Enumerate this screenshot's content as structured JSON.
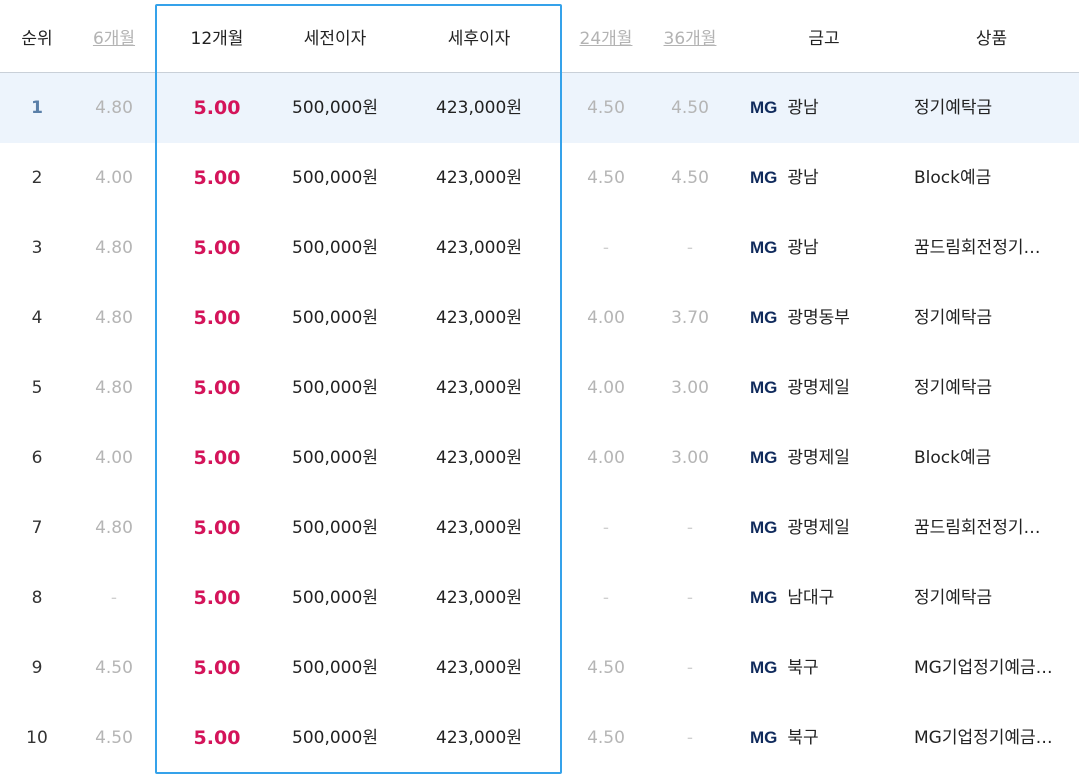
{
  "header": {
    "rank": "순위",
    "m6": "6개월",
    "m12": "12개월",
    "pretax": "세전이자",
    "posttax": "세후이자",
    "m24": "24개월",
    "m36": "36개월",
    "bank": "금고",
    "product": "상품"
  },
  "rows": [
    {
      "rank": "1",
      "m6": "4.80",
      "m12": "5.00",
      "pretax": "500,000원",
      "posttax": "423,000원",
      "m24": "4.50",
      "m36": "4.50",
      "brand": "MG",
      "bank": "광남",
      "product": "정기예탁금"
    },
    {
      "rank": "2",
      "m6": "4.00",
      "m12": "5.00",
      "pretax": "500,000원",
      "posttax": "423,000원",
      "m24": "4.50",
      "m36": "4.50",
      "brand": "MG",
      "bank": "광남",
      "product": "Block예금"
    },
    {
      "rank": "3",
      "m6": "4.80",
      "m12": "5.00",
      "pretax": "500,000원",
      "posttax": "423,000원",
      "m24": "-",
      "m36": "-",
      "brand": "MG",
      "bank": "광남",
      "product": "꿈드림회전정기…"
    },
    {
      "rank": "4",
      "m6": "4.80",
      "m12": "5.00",
      "pretax": "500,000원",
      "posttax": "423,000원",
      "m24": "4.00",
      "m36": "3.70",
      "brand": "MG",
      "bank": "광명동부",
      "product": "정기예탁금"
    },
    {
      "rank": "5",
      "m6": "4.80",
      "m12": "5.00",
      "pretax": "500,000원",
      "posttax": "423,000원",
      "m24": "4.00",
      "m36": "3.00",
      "brand": "MG",
      "bank": "광명제일",
      "product": "정기예탁금"
    },
    {
      "rank": "6",
      "m6": "4.00",
      "m12": "5.00",
      "pretax": "500,000원",
      "posttax": "423,000원",
      "m24": "4.00",
      "m36": "3.00",
      "brand": "MG",
      "bank": "광명제일",
      "product": "Block예금"
    },
    {
      "rank": "7",
      "m6": "4.80",
      "m12": "5.00",
      "pretax": "500,000원",
      "posttax": "423,000원",
      "m24": "-",
      "m36": "-",
      "brand": "MG",
      "bank": "광명제일",
      "product": "꿈드림회전정기…"
    },
    {
      "rank": "8",
      "m6": "-",
      "m12": "5.00",
      "pretax": "500,000원",
      "posttax": "423,000원",
      "m24": "-",
      "m36": "-",
      "brand": "MG",
      "bank": "남대구",
      "product": "정기예탁금"
    },
    {
      "rank": "9",
      "m6": "4.50",
      "m12": "5.00",
      "pretax": "500,000원",
      "posttax": "423,000원",
      "m24": "4.50",
      "m36": "-",
      "brand": "MG",
      "bank": "북구",
      "product": "MG기업정기예금…"
    },
    {
      "rank": "10",
      "m6": "4.50",
      "m12": "5.00",
      "pretax": "500,000원",
      "posttax": "423,000원",
      "m24": "4.50",
      "m36": "-",
      "brand": "MG",
      "bank": "북구",
      "product": "MG기업정기예금…"
    }
  ],
  "colors": {
    "accent_rate": "#d4145a",
    "focus_border": "#35a2ea",
    "highlight_row": "#edf4fc",
    "brand_mg": "#0f2a5c"
  }
}
